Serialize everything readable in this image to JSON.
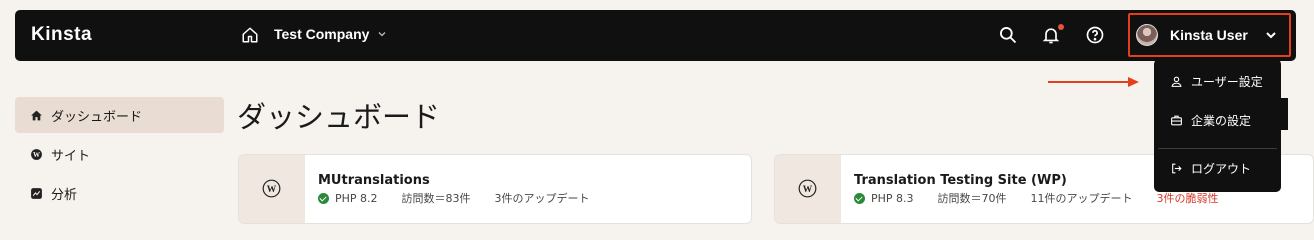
{
  "header": {
    "logo": "Kinsta",
    "company": "Test Company",
    "user_name": "Kinsta User"
  },
  "sidebar": {
    "items": [
      {
        "label": "ダッシュボード",
        "icon": "home-icon",
        "active": true
      },
      {
        "label": "サイト",
        "icon": "wordpress-icon"
      },
      {
        "label": "分析",
        "icon": "analytics-icon"
      }
    ]
  },
  "main": {
    "title": "ダッシュボード",
    "sites": [
      {
        "name": "MUtranslations",
        "php": "PHP 8.2",
        "visits": "訪問数＝83件",
        "updates": "3件のアップデート",
        "warning": ""
      },
      {
        "name": "Translation Testing Site (WP)",
        "php": "PHP 8.3",
        "visits": "訪問数＝70件",
        "updates": "11件のアップデート",
        "warning": "3件の脆弱性"
      }
    ]
  },
  "user_menu": {
    "items": [
      {
        "label": "ユーザー設定",
        "icon": "user-icon"
      },
      {
        "label": "企業の設定",
        "icon": "briefcase-icon"
      },
      {
        "label": "ログアウト",
        "icon": "logout-icon"
      }
    ]
  },
  "colors": {
    "topbar": "#101010",
    "highlight": "#e53e1a",
    "success": "#2a8a3a",
    "warning": "#d63a2a"
  }
}
